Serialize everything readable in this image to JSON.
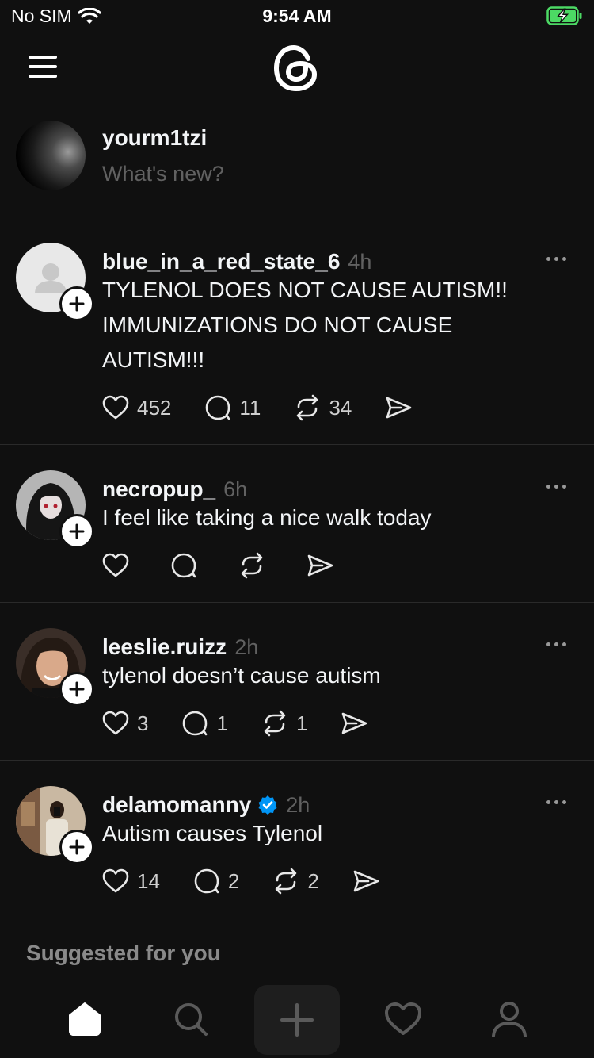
{
  "status": {
    "carrier": "No SIM",
    "time": "9:54 AM"
  },
  "composer": {
    "username": "yourm1tzi",
    "placeholder": "What's new?"
  },
  "posts": [
    {
      "username": "blue_in_a_red_state_6",
      "time": "4h",
      "verified": false,
      "text": "TYLENOL DOES NOT CAUSE AUTISM!! IMMUNIZATIONS DO NOT CAUSE AUTISM!!!",
      "likes": "452",
      "comments": "11",
      "reposts": "34",
      "avatar": "default-avatar-icon"
    },
    {
      "username": "necropup_",
      "time": "6h",
      "verified": false,
      "text": "I feel like taking a nice walk today",
      "likes": "",
      "comments": "",
      "reposts": "",
      "avatar": "anime-avatar"
    },
    {
      "username": "leeslie.ruizz",
      "time": "2h",
      "verified": false,
      "text": "tylenol doesn’t cause autism",
      "likes": "3",
      "comments": "1",
      "reposts": "1",
      "avatar": "photo-avatar"
    },
    {
      "username": "delamomanny",
      "time": "2h",
      "verified": true,
      "text": "Autism causes Tylenol",
      "likes": "14",
      "comments": "2",
      "reposts": "2",
      "avatar": "photo-avatar"
    }
  ],
  "suggested_label": "Suggested for you",
  "tabs": [
    "home-icon",
    "search-icon",
    "create-icon",
    "activity-heart-icon",
    "profile-icon"
  ],
  "colors": {
    "background": "#101010",
    "text": "#f3f5f7",
    "muted": "#616161",
    "battery": "#4cd964",
    "verified": "#0095f6"
  }
}
